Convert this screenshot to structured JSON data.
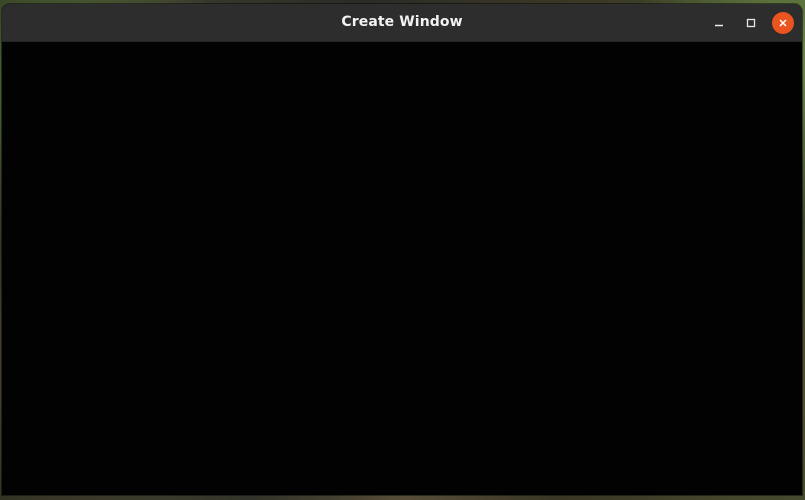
{
  "window": {
    "title": "Create Window"
  },
  "titlebar": {
    "controls": {
      "minimize_icon": "minimize-icon",
      "maximize_icon": "maximize-icon",
      "close_icon": "close-icon",
      "close_color": "#e95420"
    }
  },
  "theme": {
    "window_background": "#000000",
    "titlebar_background": "#2d2d2d"
  }
}
